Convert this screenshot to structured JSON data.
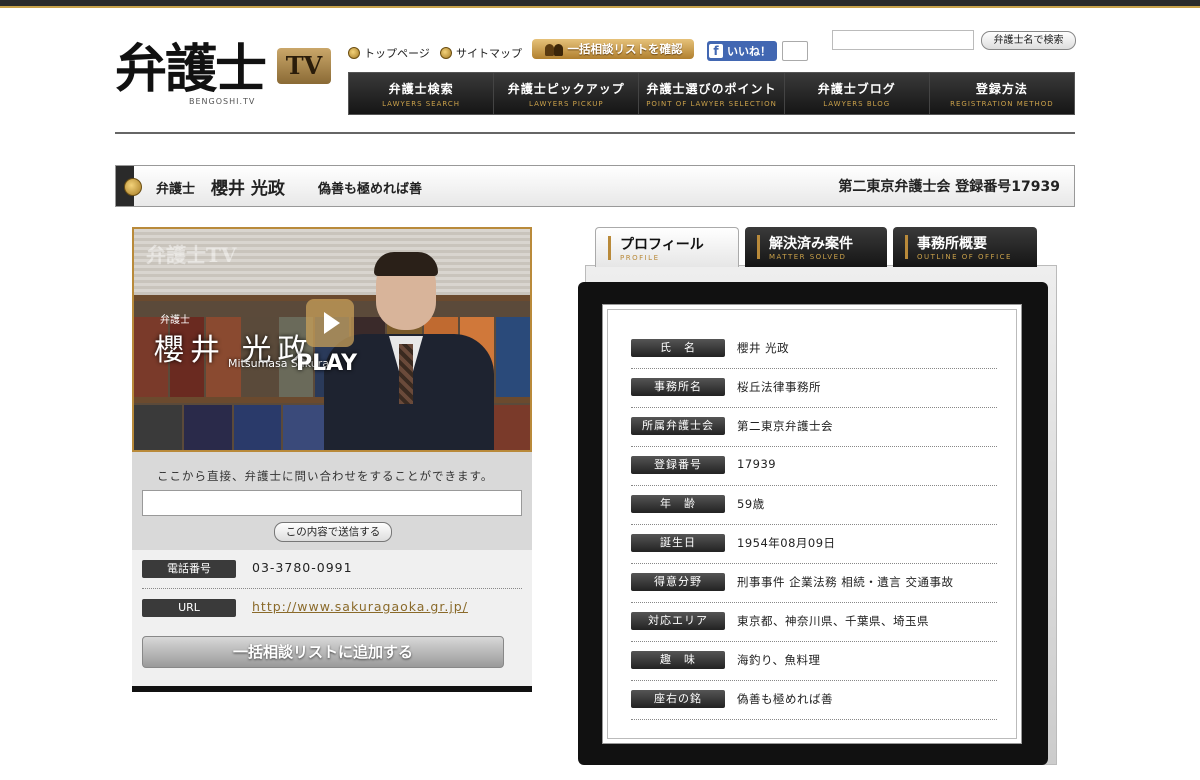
{
  "site": {
    "logo_kanji": "弁護士",
    "logo_tv": "TV",
    "logo_sub": "BENGOSHI.TV"
  },
  "header": {
    "links": [
      {
        "label": "トップページ"
      },
      {
        "label": "サイトマップ"
      }
    ],
    "consult_list_button": "一括相談リストを確認",
    "fb_like": "いいね！",
    "search_button": "弁護士名で検索",
    "search_value": ""
  },
  "nav": [
    {
      "jp": "弁護士検索",
      "en": "LAWYERS SEARCH"
    },
    {
      "jp": "弁護士ピックアップ",
      "en": "LAWYERS PICKUP"
    },
    {
      "jp": "弁護士選びのポイント",
      "en": "POINT OF LAWYER SELECTION"
    },
    {
      "jp": "弁護士ブログ",
      "en": "LAWYERS BLOG"
    },
    {
      "jp": "登録方法",
      "en": "REGISTRATION METHOD"
    }
  ],
  "title_bar": {
    "label": "弁護士",
    "name": "櫻井 光政",
    "motto": "偽善も極めれば善",
    "registration": "第二東京弁護士会 登録番号17939"
  },
  "video": {
    "watermark": "弁護士TV",
    "title_small": "弁護士",
    "title_name": "櫻井 光政",
    "title_roman": "Mitsumasa Sakurai",
    "play_label": "PLAY"
  },
  "contact": {
    "text": "ここから直接、弁護士に問い合わせをすることができます。",
    "textarea_value": "",
    "submit_button": "この内容で送信する"
  },
  "info": {
    "phone_label": "電話番号",
    "phone_value": "03-3780-0991",
    "url_label": "URL",
    "url_value": "http://www.sakuragaoka.gr.jp/",
    "add_button": "一括相談リストに追加する"
  },
  "tabs": [
    {
      "jp": "プロフィール",
      "en": "PROFILE",
      "active": true
    },
    {
      "jp": "解決済み案件",
      "en": "MATTER SOLVED",
      "active": false
    },
    {
      "jp": "事務所概要",
      "en": "OUTLINE OF OFFICE",
      "active": false
    }
  ],
  "profile": [
    {
      "label": "氏　名",
      "value": "櫻井 光政"
    },
    {
      "label": "事務所名",
      "value": "桜丘法律事務所"
    },
    {
      "label": "所属弁護士会",
      "value": "第二東京弁護士会"
    },
    {
      "label": "登録番号",
      "value": "17939"
    },
    {
      "label": "年　齢",
      "value": "59歳"
    },
    {
      "label": "誕生日",
      "value": "1954年08月09日"
    },
    {
      "label": "得意分野",
      "value": "刑事事件 企業法務 相続・遺言 交通事故"
    },
    {
      "label": "対応エリア",
      "value": "東京都、神奈川県、千葉県、埼玉県"
    },
    {
      "label": "趣　味",
      "value": "海釣り、魚料理"
    },
    {
      "label": "座右の銘",
      "value": "偽善も極めれば善"
    }
  ],
  "colors": {
    "gold": "#b98a3a",
    "dark": "#1f1f1f",
    "facebook": "#4267b2"
  }
}
